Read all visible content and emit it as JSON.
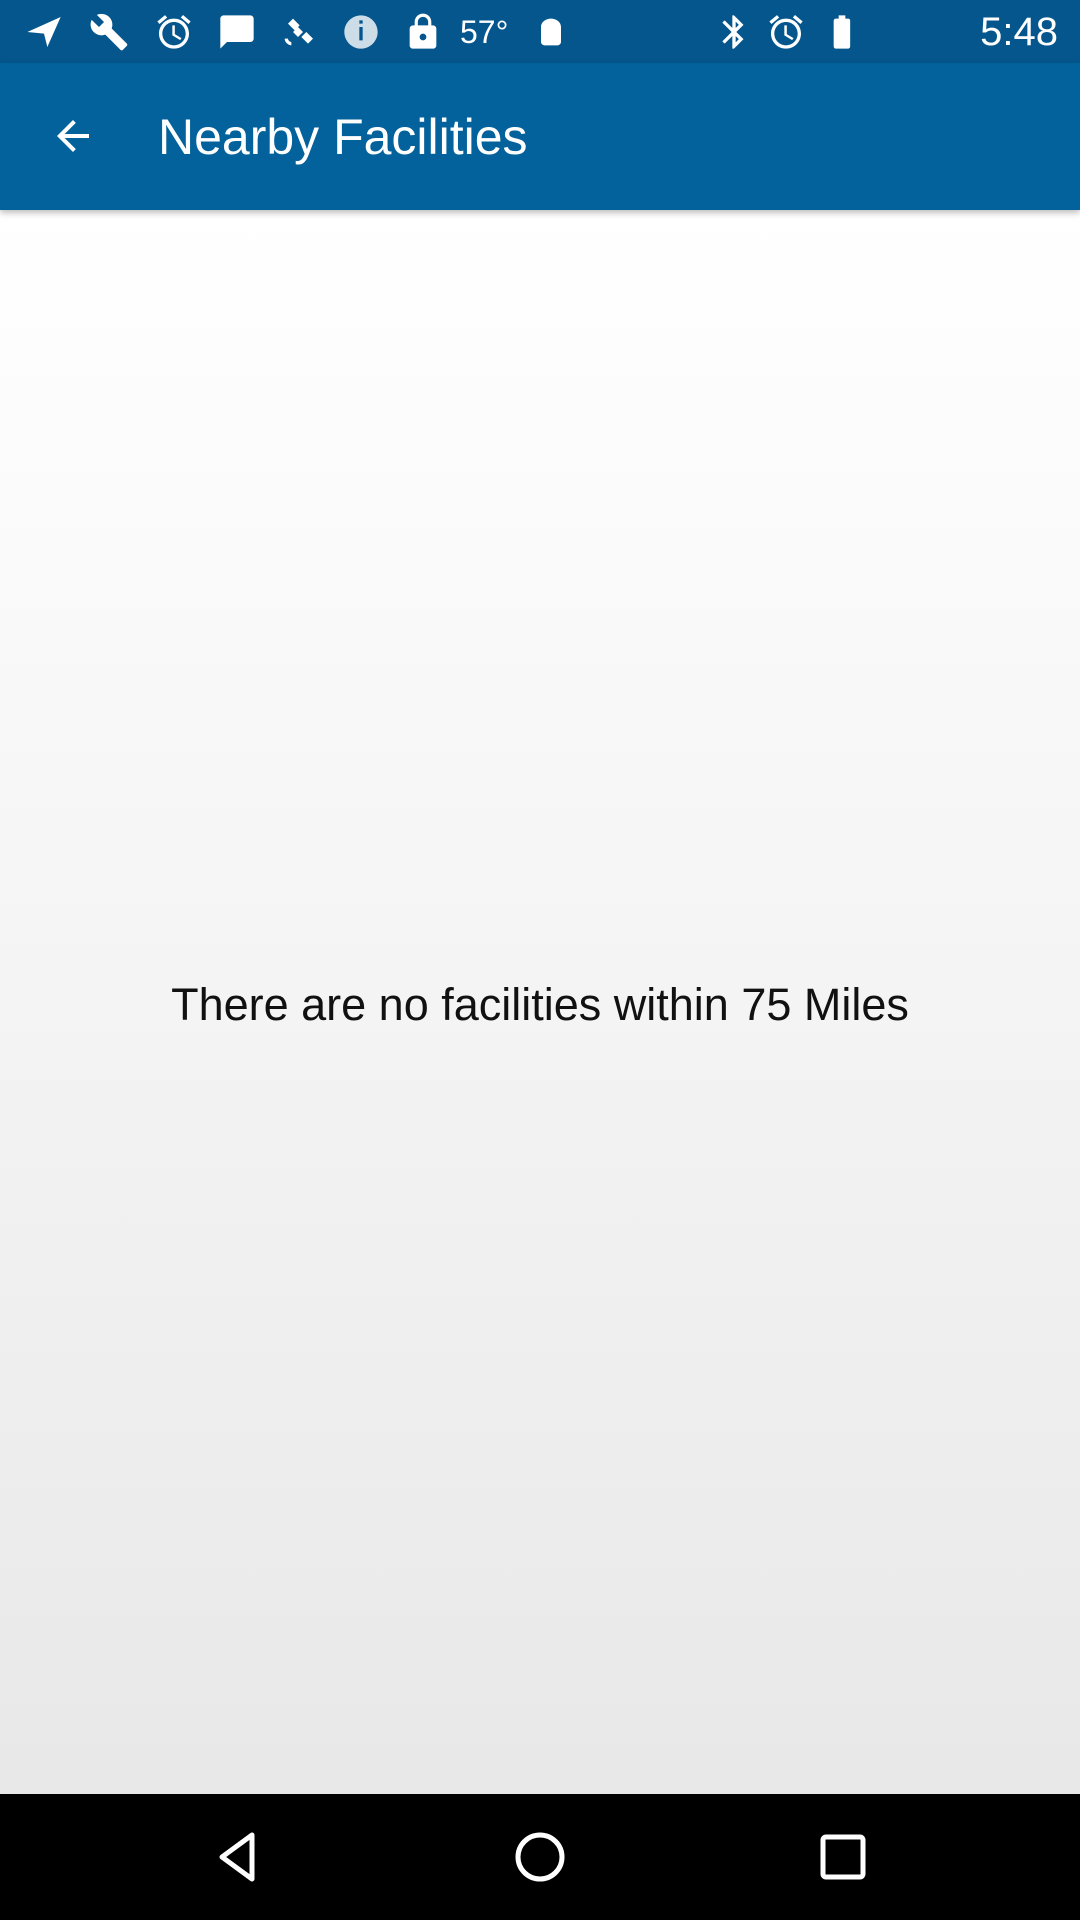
{
  "status_bar": {
    "temperature": "57°",
    "time": "5:48",
    "icons": [
      "navigation-icon",
      "wrench-icon",
      "alarm-icon",
      "message-icon",
      "fake-gps-icon",
      "info-icon",
      "lock-icon",
      "android-icon",
      "bluetooth-icon",
      "alarm-icon"
    ]
  },
  "app_bar": {
    "title": "Nearby Facilities",
    "back_icon": "arrow-back-icon"
  },
  "content": {
    "empty_message": "There are no facilities within 75 Miles"
  },
  "nav_bar": {
    "buttons": [
      "back-triangle-icon",
      "home-circle-icon",
      "recents-square-icon"
    ]
  },
  "colors": {
    "status_bar": "#04568c",
    "app_bar": "#03629b"
  }
}
